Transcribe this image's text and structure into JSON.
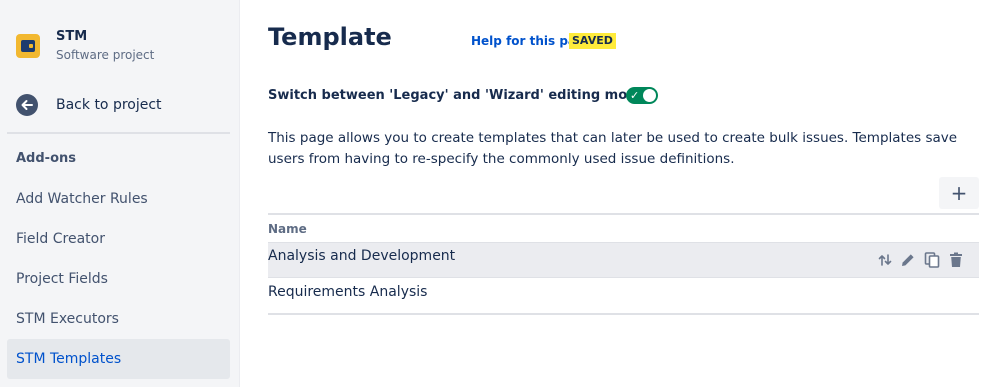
{
  "sidebar": {
    "project_name": "STM",
    "project_type": "Software project",
    "back_label": "Back to project",
    "section_title": "Add-ons",
    "items": [
      {
        "label": "Add Watcher Rules"
      },
      {
        "label": "Field Creator"
      },
      {
        "label": "Project Fields"
      },
      {
        "label": "STM Executors"
      },
      {
        "label": "STM Templates",
        "active": true
      }
    ]
  },
  "header": {
    "title": "Template",
    "help_link": "Help for this page",
    "saved_badge": "SAVED"
  },
  "switch": {
    "label": "Switch between 'Legacy' and 'Wizard' editing modes:",
    "state": "on"
  },
  "description": "This page allows you to create templates that can later be used to create bulk issues. Templates save users from having to re-specify the commonly used issue definitions.",
  "add_button": "+",
  "table": {
    "column_header": "Name",
    "rows": [
      {
        "name": "Analysis and Development"
      },
      {
        "name": "Requirements Analysis"
      }
    ]
  },
  "icons": {
    "row_actions": [
      "sort-icon",
      "edit-icon",
      "copy-icon",
      "delete-icon"
    ]
  },
  "colors": {
    "accent": "#0052cc",
    "toggle_on": "#00875a",
    "saved_highlight": "#ffeb3b"
  }
}
